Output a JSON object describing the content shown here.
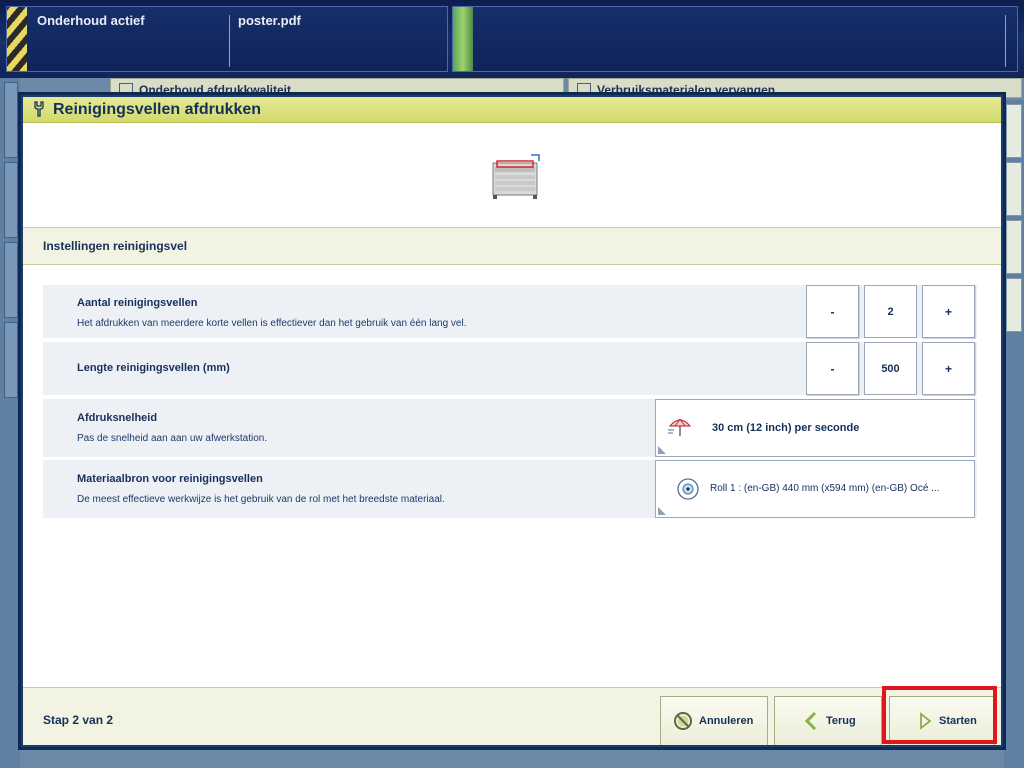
{
  "status_bar": {
    "maintenance_text": "Onderhoud actief",
    "job_name": "poster.pdf"
  },
  "background_tabs": {
    "quality_tab": "Onderhoud afdrukkwaliteit",
    "consumables_tab": "Verbruiksmaterialen vervangen"
  },
  "dialog": {
    "title": "Reinigingsvellen afdrukken",
    "section_title": "Instellingen reinigingsvel",
    "settings": {
      "sheet_count": {
        "title": "Aantal reinigingsvellen",
        "description": "Het afdrukken van meerdere korte vellen is effectiever dan het gebruik van één lang vel.",
        "decrement_label": "-",
        "value": "2",
        "increment_label": "+"
      },
      "sheet_length": {
        "title": "Lengte reinigingsvellen (mm)",
        "decrement_label": "-",
        "value": "500",
        "increment_label": "+"
      },
      "print_speed": {
        "title": "Afdruksnelheid",
        "description": "Pas de snelheid aan aan uw afwerkstation.",
        "value": "30 cm (12 inch) per seconde",
        "icon": "umbrella-speed-icon"
      },
      "media_source": {
        "title": "Materiaalbron voor reinigingsvellen",
        "description": "De meest effectieve werkwijze is het gebruik van de rol met het breedste materiaal.",
        "value": "Roll 1 : (en-GB) 440 mm (x594 mm) (en-GB) Océ ...",
        "icon": "media-roll-icon"
      }
    },
    "footer": {
      "step": "Stap 2 van 2",
      "cancel_label": "Annuleren",
      "back_label": "Terug",
      "start_label": "Starten"
    }
  },
  "colors": {
    "title_bar": "#d3da6b",
    "dialog_border": "#1b3d6d",
    "highlight": "#e0161d",
    "text": "#16305b"
  }
}
